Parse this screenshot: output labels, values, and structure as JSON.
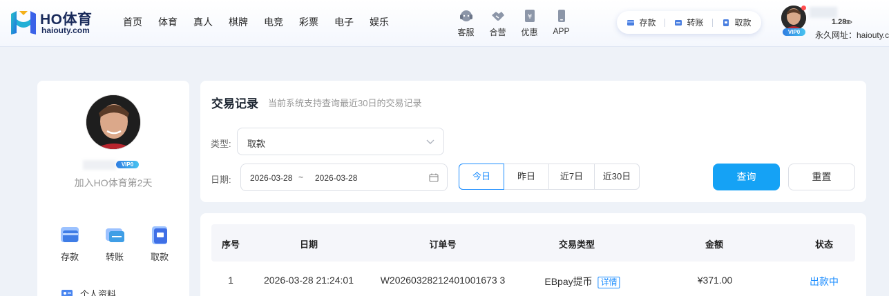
{
  "brand": {
    "name": "HO体育",
    "domain": "haiouty.com",
    "colors": {
      "primary": "#15a2f5",
      "accent_blue": "#1a8cff",
      "dark_navy": "#1a2b5b"
    }
  },
  "nav": {
    "items": [
      {
        "label": "首页"
      },
      {
        "label": "体育"
      },
      {
        "label": "真人"
      },
      {
        "label": "棋牌"
      },
      {
        "label": "电竞"
      },
      {
        "label": "彩票"
      },
      {
        "label": "电子"
      },
      {
        "label": "娱乐"
      }
    ]
  },
  "tools": [
    {
      "label": "客服",
      "icon": "headset-icon"
    },
    {
      "label": "合营",
      "icon": "handshake-icon"
    },
    {
      "label": "优惠",
      "icon": "coupon-icon"
    },
    {
      "label": "APP",
      "icon": "phone-icon"
    }
  ],
  "quick_actions": [
    {
      "label": "存款",
      "icon": "deposit-icon"
    },
    {
      "label": "转账",
      "icon": "transfer-icon"
    },
    {
      "label": "取款",
      "icon": "withdraw-icon"
    }
  ],
  "user": {
    "vip_badge": "VIP0",
    "balance": "1.28",
    "permanent_url": "永久网址：haiouty.com"
  },
  "profile": {
    "vip_badge": "VIP0",
    "join_text": "加入HO体育第2天",
    "actions": [
      {
        "label": "存款",
        "icon": "deposit-card-icon"
      },
      {
        "label": "转账",
        "icon": "transfer-card-icon"
      },
      {
        "label": "取款",
        "icon": "withdraw-card-icon"
      }
    ],
    "menu_first": {
      "label": "个人资料",
      "icon": "id-card-icon"
    }
  },
  "filter": {
    "title": "交易记录",
    "subtitle": "当前系统支持查询最近30日的交易记录",
    "type_label": "类型:",
    "type_value": "取款",
    "date_label": "日期:",
    "date_start": "2026-03-28",
    "date_separator": "~",
    "date_end": "2026-03-28",
    "quick_ranges": [
      {
        "label": "今日",
        "active": true
      },
      {
        "label": "昨日",
        "active": false
      },
      {
        "label": "近7日",
        "active": false
      },
      {
        "label": "近30日",
        "active": false
      }
    ],
    "search_label": "查询",
    "reset_label": "重置"
  },
  "table": {
    "headers": [
      "序号",
      "日期",
      "订单号",
      "交易类型",
      "金额",
      "状态"
    ],
    "rows": [
      {
        "index": "1",
        "date": "2026-03-28 21:24:01",
        "order_no": "W20260328212401001673 3",
        "type": "EBpay提币",
        "detail_label": "详情",
        "amount": "¥371.00",
        "status": "出款中"
      }
    ]
  }
}
